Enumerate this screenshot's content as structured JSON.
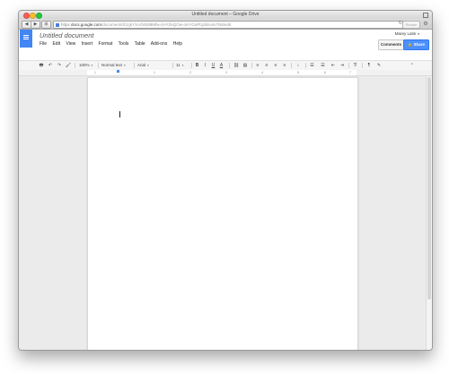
{
  "window": {
    "title": "Untitled document – Google Drive"
  },
  "browser": {
    "back_glyph": "◀",
    "forward_glyph": "▶",
    "tabs_glyph": "⊞",
    "url_scheme": "https",
    "url_host": "docs.google.com",
    "url_path": "/document/d/11jkYXAOi0dI8Mfw-cHYZeQOw-oHYGuPbj1Bsv4v7N8/edit",
    "reader_label": "Reader",
    "reload_glyph": "↻",
    "gear_glyph": "⚙"
  },
  "docs": {
    "title": "Untitled document",
    "user_name": "Marey Latin",
    "comments_label": "Comments",
    "share_label": "Share",
    "menu": [
      "File",
      "Edit",
      "View",
      "Insert",
      "Format",
      "Tools",
      "Table",
      "Add-ons",
      "Help"
    ]
  },
  "toolbar": {
    "zoom": "100%",
    "style": "Normal text",
    "font": "Arial",
    "size": "11",
    "bold": "B",
    "italic": "I",
    "underline": "U",
    "text_color": "A",
    "print_glyph": "🖶",
    "undo_glyph": "↶",
    "redo_glyph": "↷",
    "paint_glyph": "🖌",
    "link_glyph": "⛓",
    "comment_glyph": "▤",
    "collapse_glyph": "⌃"
  },
  "ruler": {
    "numbers": [
      "1",
      "1",
      "2",
      "3",
      "4",
      "5",
      "6",
      "7"
    ]
  },
  "colors": {
    "accent": "#4285f4",
    "share": "#4d90fe"
  }
}
